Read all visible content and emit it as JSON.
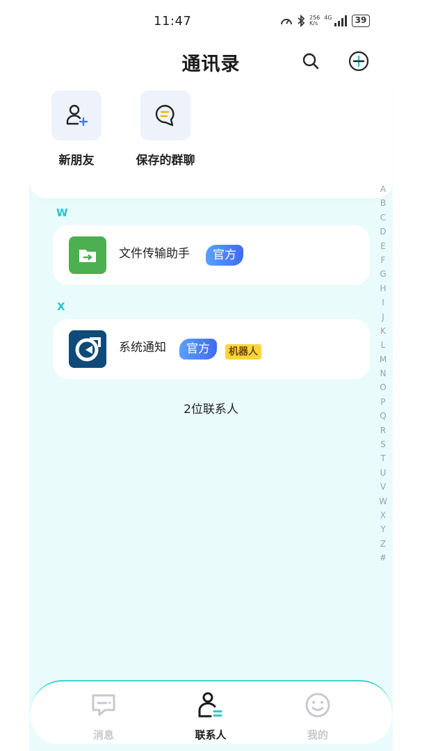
{
  "status_bar": {
    "time": "11:47",
    "network_speed_value": "256",
    "network_speed_unit": "K/s",
    "network_type": "4G",
    "battery": "39"
  },
  "header": {
    "title": "通讯录",
    "search_icon": "search-icon",
    "add_icon": "plus-circle-icon"
  },
  "quick_actions": [
    {
      "label": "新朋友",
      "icon": "add-person-icon"
    },
    {
      "label": "保存的群聊",
      "icon": "group-chat-icon"
    }
  ],
  "sections": [
    {
      "letter": "W",
      "contacts": [
        {
          "name": "文件传输助手",
          "badges": [
            "官方"
          ],
          "avatar_color": "#4caf50"
        }
      ]
    },
    {
      "letter": "X",
      "contacts": [
        {
          "name": "系统通知",
          "badges": [
            "官方",
            "机器人"
          ],
          "avatar_color": "#0f4a78"
        }
      ]
    }
  ],
  "contact_count": "2位联系人",
  "alphabet": [
    "A",
    "B",
    "C",
    "D",
    "E",
    "F",
    "G",
    "H",
    "I",
    "J",
    "K",
    "L",
    "M",
    "N",
    "O",
    "P",
    "Q",
    "R",
    "S",
    "T",
    "U",
    "V",
    "W",
    "X",
    "Y",
    "Z",
    "#"
  ],
  "bottom_nav": [
    {
      "label": "消息",
      "icon": "message-icon",
      "active": false
    },
    {
      "label": "联系人",
      "icon": "contacts-icon",
      "active": true
    },
    {
      "label": "我的",
      "icon": "smile-icon",
      "active": false
    }
  ],
  "colors": {
    "accent": "#22c7cf",
    "official_badge": "#3f6bf0",
    "robot_badge": "#ffd43a",
    "content_bg": "#eafbfc"
  }
}
